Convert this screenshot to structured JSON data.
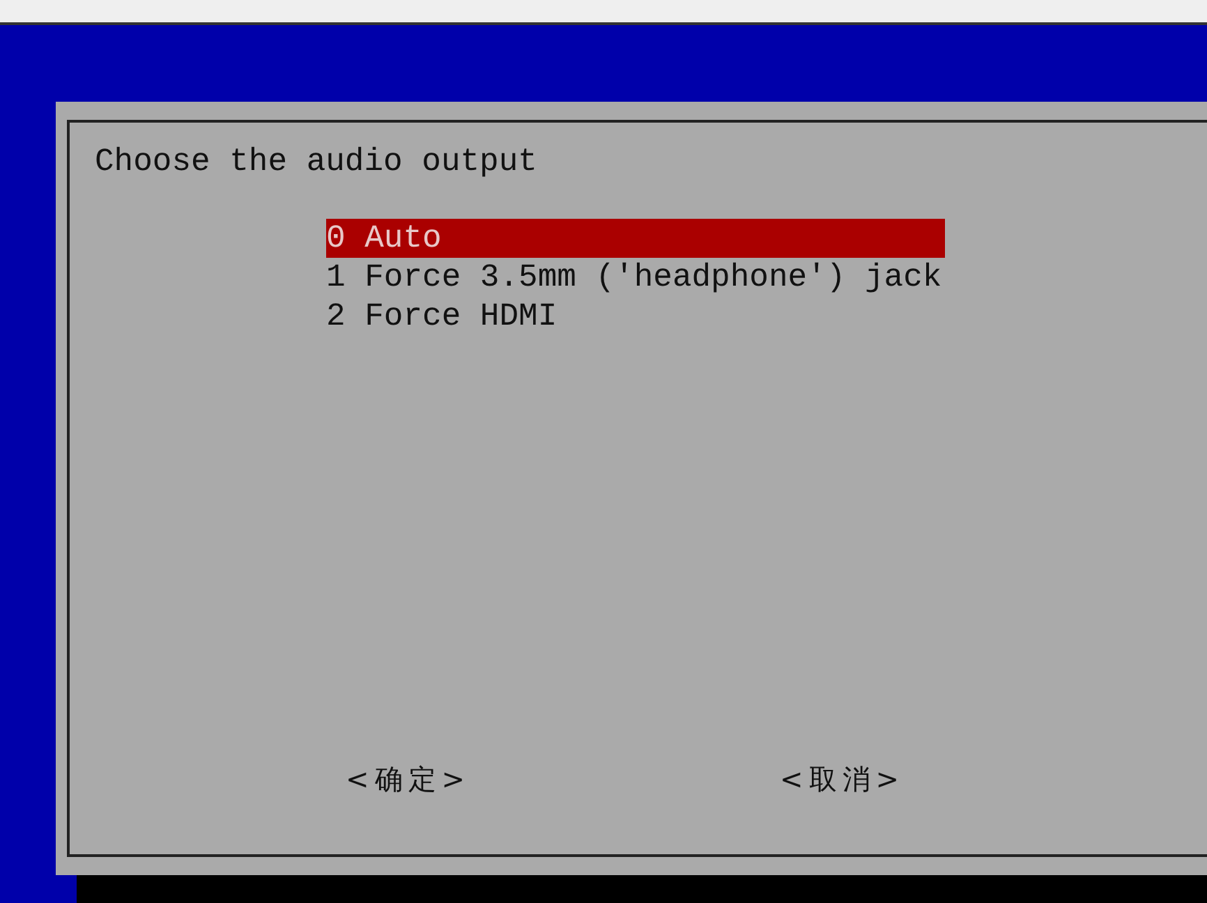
{
  "dialog": {
    "prompt": "Choose the audio output",
    "items": [
      {
        "label": "0 Auto",
        "selected": true
      },
      {
        "label": "1 Force 3.5mm ('headphone') jack",
        "selected": false
      },
      {
        "label": "2 Force HDMI",
        "selected": false
      }
    ],
    "buttons": [
      "<确定>",
      "<取消>"
    ]
  }
}
